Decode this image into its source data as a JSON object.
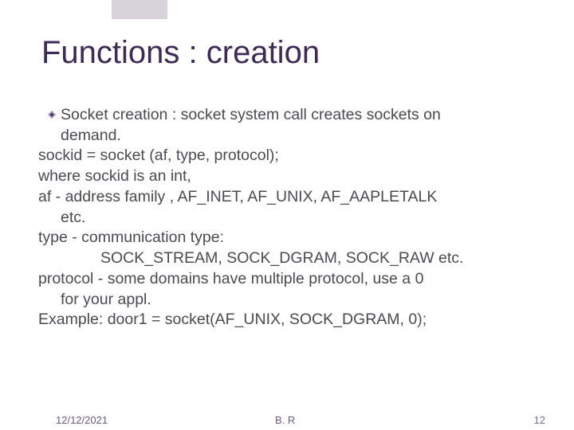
{
  "slide": {
    "title": "Functions : creation",
    "lines": {
      "l1a": "Socket creation : socket system call creates sockets on",
      "l1b": "demand.",
      "l2": "sockid = socket (af, type, protocol);",
      "l3": "where sockid is an int,",
      "l4a": "af - address family , AF_INET, AF_UNIX, AF_AAPLETALK",
      "l4b": "etc.",
      "l5": "type - communication type:",
      "l6": "SOCK_STREAM, SOCK_DGRAM, SOCK_RAW etc.",
      "l7a": "protocol - some domains have multiple protocol, use a 0",
      "l7b": "for your appl.",
      "l8": "Example: door1 = socket(AF_UNIX, SOCK_DGRAM, 0);"
    }
  },
  "footer": {
    "date": "12/12/2021",
    "author": "B. R",
    "page": "12"
  }
}
